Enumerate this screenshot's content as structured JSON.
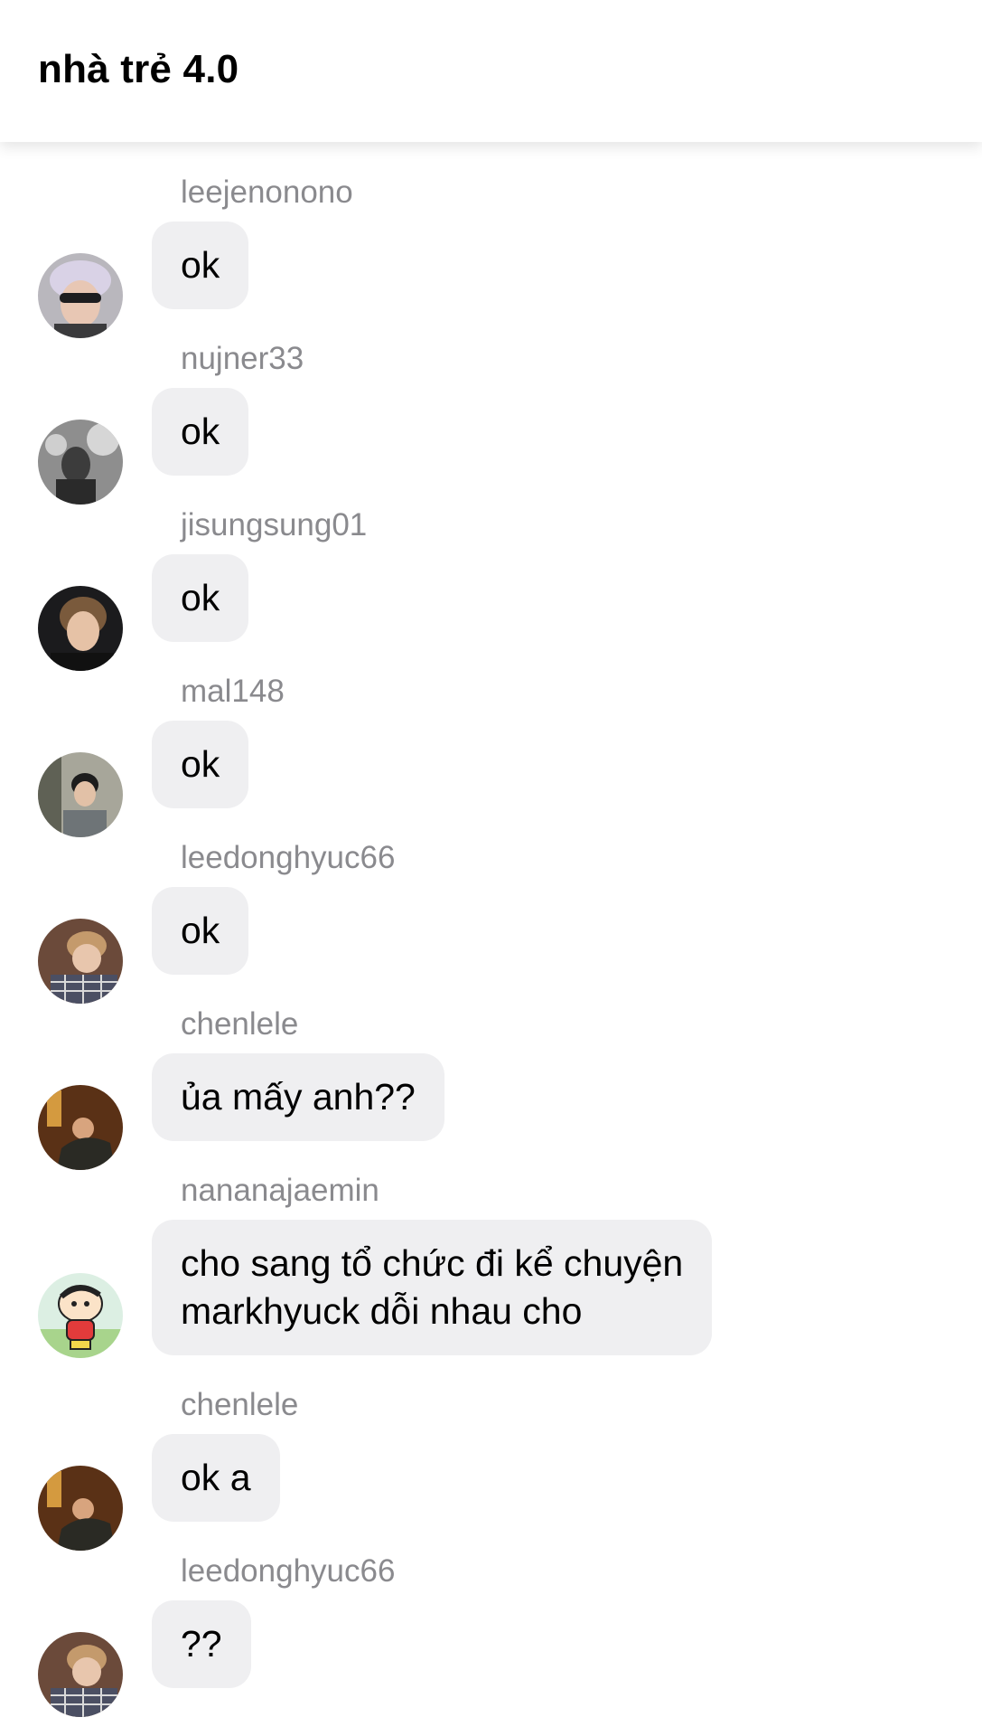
{
  "header": {
    "title": "nhà trẻ 4.0"
  },
  "messages": [
    {
      "sender": "leejenonono",
      "text": "ok",
      "avatar_icon": "user-avatar-icon"
    },
    {
      "sender": "nujner33",
      "text": "ok",
      "avatar_icon": "user-avatar-icon"
    },
    {
      "sender": "jisungsung01",
      "text": "ok",
      "avatar_icon": "user-avatar-icon"
    },
    {
      "sender": "mal148",
      "text": "ok",
      "avatar_icon": "user-avatar-icon"
    },
    {
      "sender": "leedonghyuc66",
      "text": "ok",
      "avatar_icon": "user-avatar-icon"
    },
    {
      "sender": "chenlele",
      "text": "ủa mấy anh??",
      "avatar_icon": "user-avatar-icon"
    },
    {
      "sender": "nananajaemin",
      "text": "cho sang tổ chức đi kể chuyện\nmarkhyuck dỗi nhau cho",
      "avatar_icon": "cartoon-avatar-icon"
    },
    {
      "sender": "chenlele",
      "text": "ok a",
      "avatar_icon": "user-avatar-icon"
    },
    {
      "sender": "leedonghyuc66",
      "text": "??",
      "avatar_icon": "user-avatar-icon"
    }
  ],
  "colors": {
    "bubble_background": "#efeff1",
    "sender_name": "#8a8a8e",
    "header_background": "#ffffff"
  }
}
